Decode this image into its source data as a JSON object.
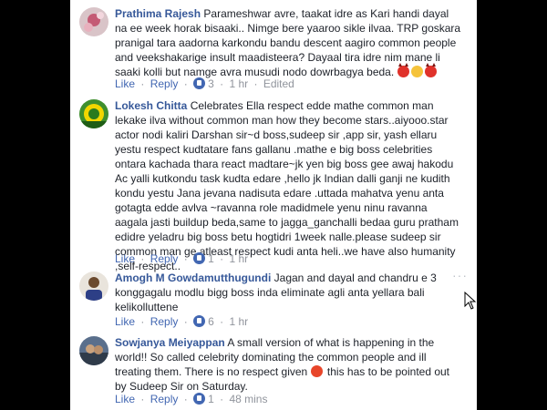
{
  "actions": {
    "like": "Like",
    "reply": "Reply",
    "separator": "·"
  },
  "comments": [
    {
      "name": "Prathima Rajesh",
      "text": "Parameshwar avre, taakat idre as Kari handi dayal na ee week horak bisaaki.. Nimge bere yaaroo sikle ilvaa. TRP goskara pranigal tara aadorna karkondu bandu descent aagiro common people and veekshakarige insult maadisteera? Dayaal tira idre nim mane li saaki kolli but namge avra musudi nodo dowrbagya beda.",
      "likes": "3",
      "time": "1 hr",
      "extra": "Edited"
    },
    {
      "name": "Lokesh Chitta",
      "text": "Celebrates Ella respect edde mathe common man lekake ilva without common man how they become stars..aiyooo.star actor nodi kaliri Darshan sir~d boss,sudeep sir ,app sir, yash ellaru yestu respect kudtatare fans gallanu .mathe e big boss celebrities ontara kachada thara react madtare~jk yen big boss gee awaj hakodu Ac yalli kutkondu task kudta edare ,hello jk Indian dalli ganji ne kudith kondu yestu Jana jevana nadisuta edare .uttada mahatva yenu anta gotagta edde avlva ~ravanna role madidmele yenu ninu ravanna aagala jasti buildup beda,same to jagga_ganchalli bedaa guru pratham edidre yeladru big boss betu hogtidri 1week nalle.please sudeep sir common man ge atleast respect kudi anta heli..we have also humanity ,self-respect..",
      "likes": "1",
      "time": "1 hr"
    },
    {
      "name": "Amogh M Gowdamutthugundi",
      "text": "Jagan and dayal and chandru e 3 konggagalu modlu bigg boss inda eliminate agli anta yellara bali kelikolluttene",
      "likes": "6",
      "time": "1 hr"
    },
    {
      "name": "Sowjanya Meiyappan",
      "text_a": "A small version of what is happening in the world!! So called celebrity dominating the common people and ill treating them. There is no respect given",
      "text_b": "this has to be pointed out by Sudeep Sir on Saturday.",
      "likes": "1",
      "time": "48 mins"
    }
  ],
  "icons": {
    "reaction_emojis_c1": [
      "devil-emoji",
      "unamused-emoji",
      "devil-emoji"
    ],
    "reaction_emoji_c4": "angry-emoji",
    "like_badge": "thumbs-up-icon",
    "more_options": "more-horizontal-icon"
  },
  "colors": {
    "name": "#365899",
    "link": "#4267b2",
    "meta": "#90949c",
    "text": "#1d2129"
  }
}
